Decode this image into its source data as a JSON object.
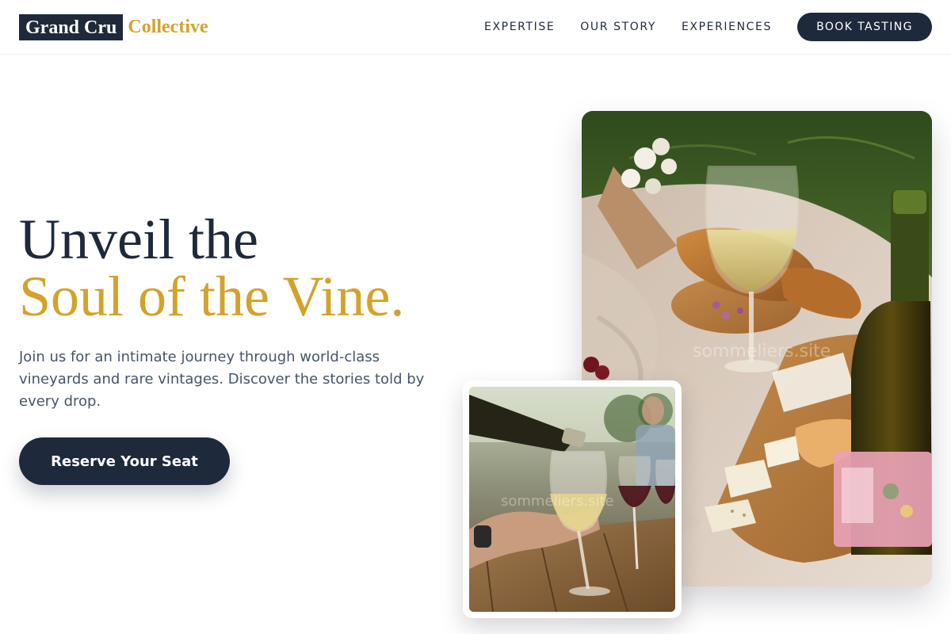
{
  "brand": {
    "name_box": "Grand Cru",
    "name_accent": "Collective"
  },
  "nav": {
    "items": [
      {
        "label": "EXPERTISE"
      },
      {
        "label": "OUR STORY"
      },
      {
        "label": "EXPERIENCES"
      }
    ],
    "cta_label": "BOOK TASTING"
  },
  "hero": {
    "headline_line1": "Unveil the",
    "headline_line2": "Soul of the Vine.",
    "subtext": "Join us for an intimate journey through world-class vineyards and rare vintages. Discover the stories told by every drop.",
    "cta_label": "Reserve Your Seat"
  },
  "images": {
    "main_watermark": "sommeliers.site",
    "small_watermark": "sommeliers.site"
  },
  "colors": {
    "navy": "#1e293b",
    "gold": "#d4a22b",
    "body_text": "#475569"
  }
}
